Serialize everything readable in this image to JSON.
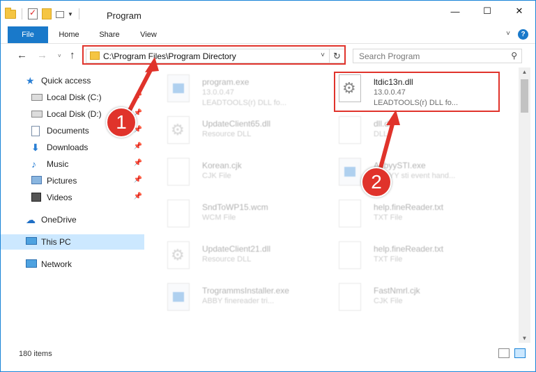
{
  "window": {
    "title": "Program",
    "controls": {
      "minimize": "—",
      "maximize": "☐",
      "close": "✕"
    }
  },
  "ribbon": {
    "tabs": [
      "File",
      "Home",
      "Share",
      "View"
    ],
    "expand_glyph": "˅",
    "help_glyph": "?"
  },
  "nav": {
    "back": "←",
    "forward": "→",
    "recent": "˅",
    "up": "↑",
    "address": "C:\\Program Files\\Program Directory",
    "address_dropdown": "˅",
    "refresh": "↻",
    "search_placeholder": "Search Program",
    "search_glyph": "⚲"
  },
  "sidebar": {
    "items": [
      {
        "label": "Quick access",
        "icon": "star-icon",
        "pinned": false
      },
      {
        "label": "Local Disk (C:)",
        "icon": "disk-icon",
        "pinned": true
      },
      {
        "label": "Local Disk (D:)",
        "icon": "disk-icon",
        "pinned": true
      },
      {
        "label": "Documents",
        "icon": "document-icon",
        "pinned": true
      },
      {
        "label": "Downloads",
        "icon": "download-icon",
        "pinned": true
      },
      {
        "label": "Music",
        "icon": "music-icon",
        "pinned": true
      },
      {
        "label": "Pictures",
        "icon": "picture-icon",
        "pinned": true
      },
      {
        "label": "Videos",
        "icon": "video-icon",
        "pinned": true
      },
      {
        "label": "OneDrive",
        "icon": "cloud-icon",
        "pinned": false
      },
      {
        "label": "This PC",
        "icon": "computer-icon",
        "pinned": false,
        "selected": true
      },
      {
        "label": "Network",
        "icon": "network-icon",
        "pinned": false
      }
    ],
    "pin_glyph": "📌"
  },
  "files": [
    {
      "name": "program.exe",
      "meta1": "13.0.0.47",
      "meta2": "LEADTOOLS(r) DLL fo...",
      "icon": "app",
      "faded": true
    },
    {
      "name": "ltdic13n.dll",
      "meta1": "13.0.0.47",
      "meta2": "LEADTOOLS(r) DLL fo...",
      "icon": "gear",
      "faded": false
    },
    {
      "name": "UpdateClient65.dll",
      "meta1": "Resource DLL",
      "meta2": "",
      "icon": "gear",
      "faded": true
    },
    {
      "name": "dll.dll",
      "meta1": "DLL",
      "meta2": "",
      "icon": "gear",
      "faded": true
    },
    {
      "name": "Korean.cjk",
      "meta1": "CJK File",
      "meta2": "",
      "icon": "blank",
      "faded": true
    },
    {
      "name": "AbbyySTI.exe",
      "meta1": "ABBYY sti event hand...",
      "meta2": "",
      "icon": "app",
      "faded": true
    },
    {
      "name": "SndToWP15.wcm",
      "meta1": "WCM File",
      "meta2": "",
      "icon": "blank",
      "faded": true
    },
    {
      "name": "help.fineReader.txt",
      "meta1": "TXT File",
      "meta2": "",
      "icon": "blank",
      "faded": true
    },
    {
      "name": "UpdateClient21.dll",
      "meta1": "Resource DLL",
      "meta2": "",
      "icon": "gear",
      "faded": true
    },
    {
      "name": "help.fineReader.txt",
      "meta1": "TXT File",
      "meta2": "",
      "icon": "blank",
      "faded": true
    },
    {
      "name": "TrogrammsInstaller.exe",
      "meta1": "ABBY finereader tri...",
      "meta2": "",
      "icon": "app",
      "faded": true
    },
    {
      "name": "FastNmrl.cjk",
      "meta1": "CJK File",
      "meta2": "",
      "icon": "blank",
      "faded": true
    }
  ],
  "scrollbar": {
    "up": "▲",
    "down": "▼"
  },
  "status": {
    "item_count": "180 items"
  },
  "annotations": {
    "step1": "1",
    "step2": "2",
    "highlight_color": "#e0332b"
  }
}
